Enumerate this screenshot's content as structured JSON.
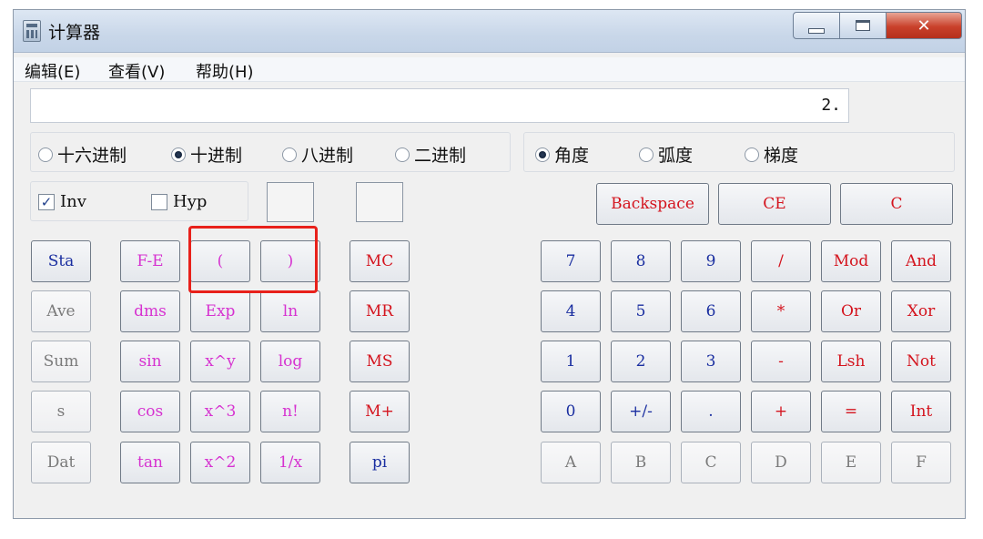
{
  "window": {
    "title": "计算器",
    "app_icon": "calculator-icon",
    "controls": [
      "minimize",
      "maximize",
      "close"
    ]
  },
  "menu": [
    {
      "label": "编辑(E)"
    },
    {
      "label": "查看(V)"
    },
    {
      "label": "帮助(H)"
    }
  ],
  "display": {
    "value": "2."
  },
  "base_modes": [
    {
      "label": "十六进制",
      "selected": false
    },
    {
      "label": "十进制",
      "selected": true
    },
    {
      "label": "八进制",
      "selected": false
    },
    {
      "label": "二进制",
      "selected": false
    }
  ],
  "angle_modes": [
    {
      "label": "角度",
      "selected": true
    },
    {
      "label": "弧度",
      "selected": false
    },
    {
      "label": "梯度",
      "selected": false
    }
  ],
  "options": {
    "inv": {
      "label": "Inv",
      "checked": true
    },
    "hyp": {
      "label": "Hyp",
      "checked": false
    }
  },
  "edit_buttons": {
    "backspace": "Backspace",
    "ce": "CE",
    "c": "C"
  },
  "stat_buttons": [
    "Sta",
    "Ave",
    "Sum",
    "s",
    "Dat"
  ],
  "function_buttons": [
    [
      "F-E",
      "(",
      ")"
    ],
    [
      "dms",
      "Exp",
      "ln"
    ],
    [
      "sin",
      "x^y",
      "log"
    ],
    [
      "cos",
      "x^3",
      "n!"
    ],
    [
      "tan",
      "x^2",
      "1/x"
    ]
  ],
  "memory_buttons": [
    "MC",
    "MR",
    "MS",
    "M+",
    "pi"
  ],
  "keypad": [
    [
      "7",
      "8",
      "9",
      "/",
      "Mod",
      "And"
    ],
    [
      "4",
      "5",
      "6",
      "*",
      "Or",
      "Xor"
    ],
    [
      "1",
      "2",
      "3",
      "-",
      "Lsh",
      "Not"
    ],
    [
      "0",
      "+/-",
      ".",
      "+",
      "=",
      "Int"
    ],
    [
      "A",
      "B",
      "C",
      "D",
      "E",
      "F"
    ]
  ],
  "colors": {
    "digit": "#1a2ea0",
    "operator": "#d4141e",
    "function": "#d632d0",
    "annotation": "#e8211b"
  }
}
